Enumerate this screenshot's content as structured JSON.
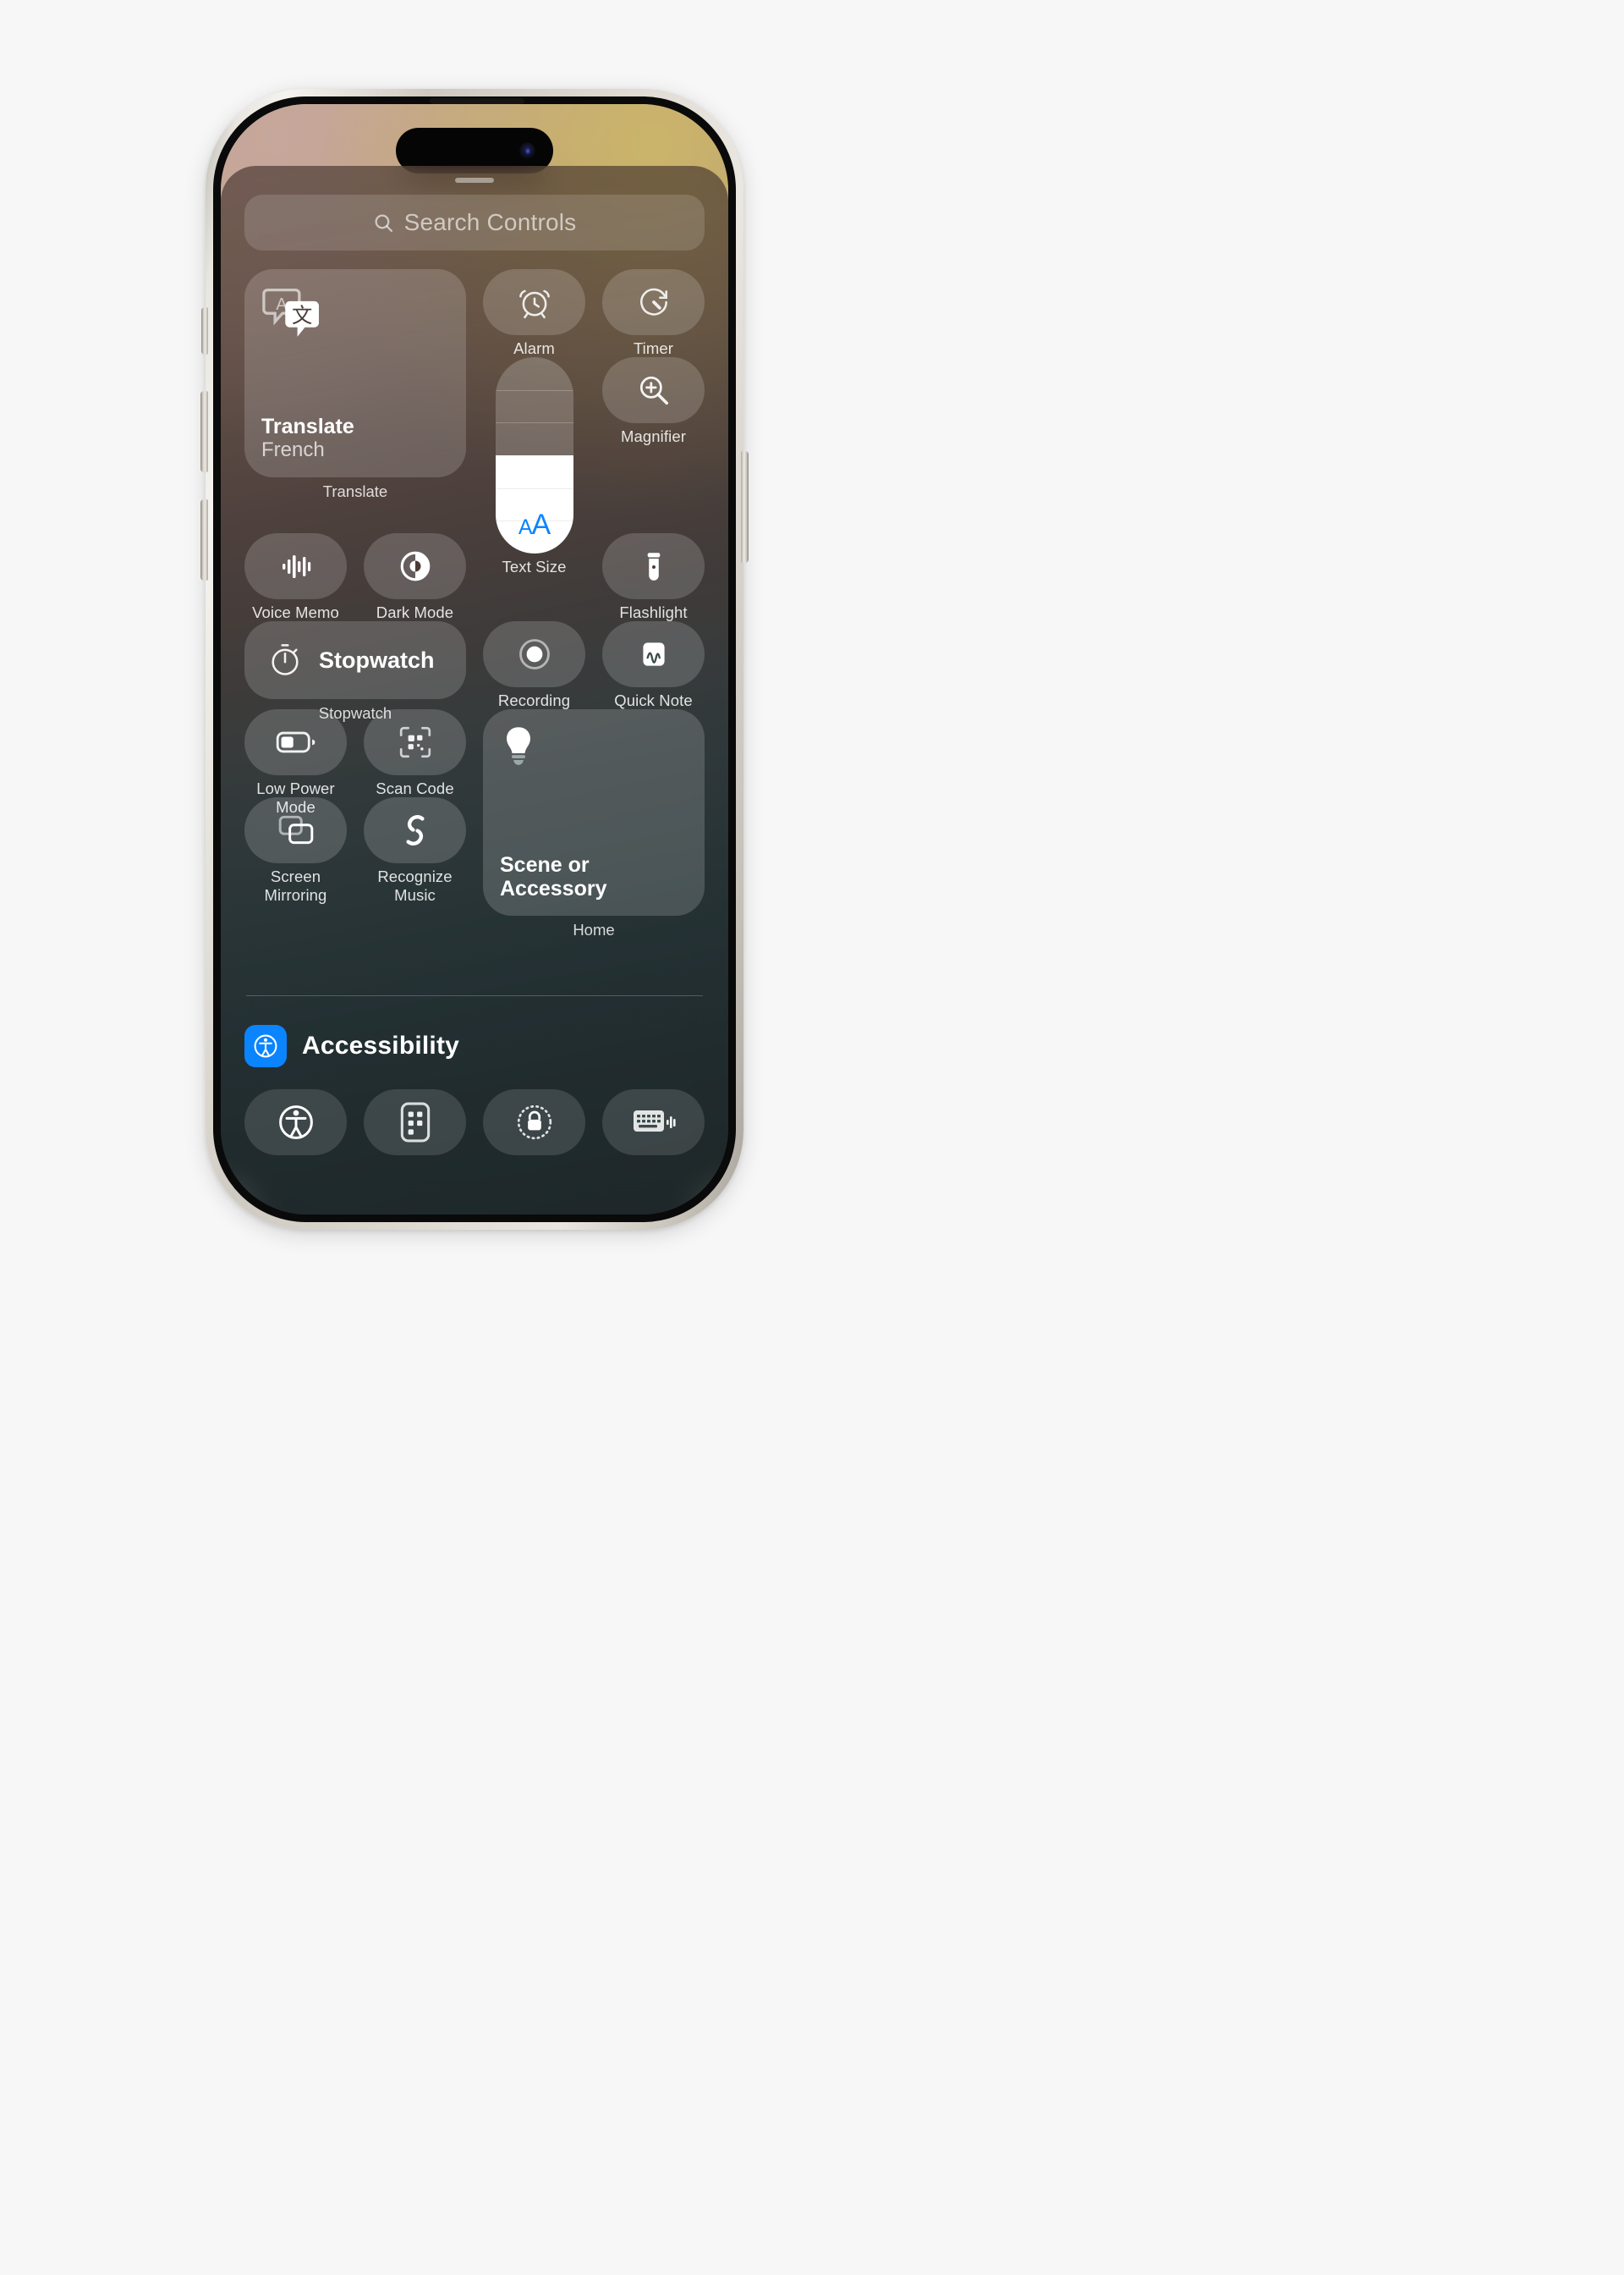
{
  "device": {
    "name": "iphone-16-pro",
    "finish_color": "#ded9d1"
  },
  "control_center": {
    "search": {
      "placeholder": "Search Controls",
      "icon": "search-icon"
    },
    "grabber": "drag-handle",
    "controls": [
      {
        "id": "translate",
        "type": "widget-large",
        "icon": "translate-icon",
        "title": "Translate",
        "subtitle": "French",
        "caption": "Translate"
      },
      {
        "id": "alarm",
        "type": "pill",
        "icon": "alarm-clock-icon",
        "label": "Alarm"
      },
      {
        "id": "timer",
        "type": "pill",
        "icon": "timer-icon",
        "label": "Timer"
      },
      {
        "id": "text_size",
        "type": "slider",
        "icon": "text-size-aa-icon",
        "label": "Text Size",
        "segments": 6,
        "filled_segments": 3,
        "accent": "#0a84ff"
      },
      {
        "id": "magnifier",
        "type": "pill",
        "icon": "magnifier-icon",
        "label": "Magnifier"
      },
      {
        "id": "voice_memo",
        "type": "pill",
        "icon": "waveform-icon",
        "label": "Voice Memo"
      },
      {
        "id": "dark_mode",
        "type": "pill",
        "icon": "dark-mode-circle-icon",
        "label": "Dark Mode"
      },
      {
        "id": "flashlight",
        "type": "pill",
        "icon": "flashlight-icon",
        "label": "Flashlight"
      },
      {
        "id": "stopwatch",
        "type": "widget-wide",
        "icon": "stopwatch-icon",
        "title": "Stopwatch",
        "caption": "Stopwatch"
      },
      {
        "id": "recording",
        "type": "pill",
        "icon": "record-dot-icon",
        "label": "Recording"
      },
      {
        "id": "quick_note",
        "type": "pill",
        "icon": "quick-note-icon",
        "label": "Quick Note"
      },
      {
        "id": "low_power_mode",
        "type": "pill",
        "icon": "battery-low-power-icon",
        "label": "Low Power Mode"
      },
      {
        "id": "scan_code",
        "type": "pill",
        "icon": "qr-scan-icon",
        "label": "Scan Code"
      },
      {
        "id": "home",
        "type": "widget-large",
        "icon": "lightbulb-icon",
        "title": "Scene or Accessory",
        "caption": "Home"
      },
      {
        "id": "screen_mirroring",
        "type": "pill",
        "icon": "screen-mirroring-icon",
        "label": "Screen Mirroring"
      },
      {
        "id": "recognize_music",
        "type": "pill",
        "icon": "shazam-icon",
        "label": "Recognize Music"
      }
    ],
    "group": {
      "title": "Accessibility",
      "icon": "accessibility-icon",
      "icon_color": "#0a84ff",
      "items": [
        {
          "id": "accessibility_shortcut",
          "icon": "accessibility-person-icon"
        },
        {
          "id": "assistive_touch",
          "icon": "assistive-touch-icon"
        },
        {
          "id": "guided_access",
          "icon": "lock-dotted-icon"
        },
        {
          "id": "live_speech",
          "icon": "keyboard-speech-icon"
        }
      ]
    }
  }
}
